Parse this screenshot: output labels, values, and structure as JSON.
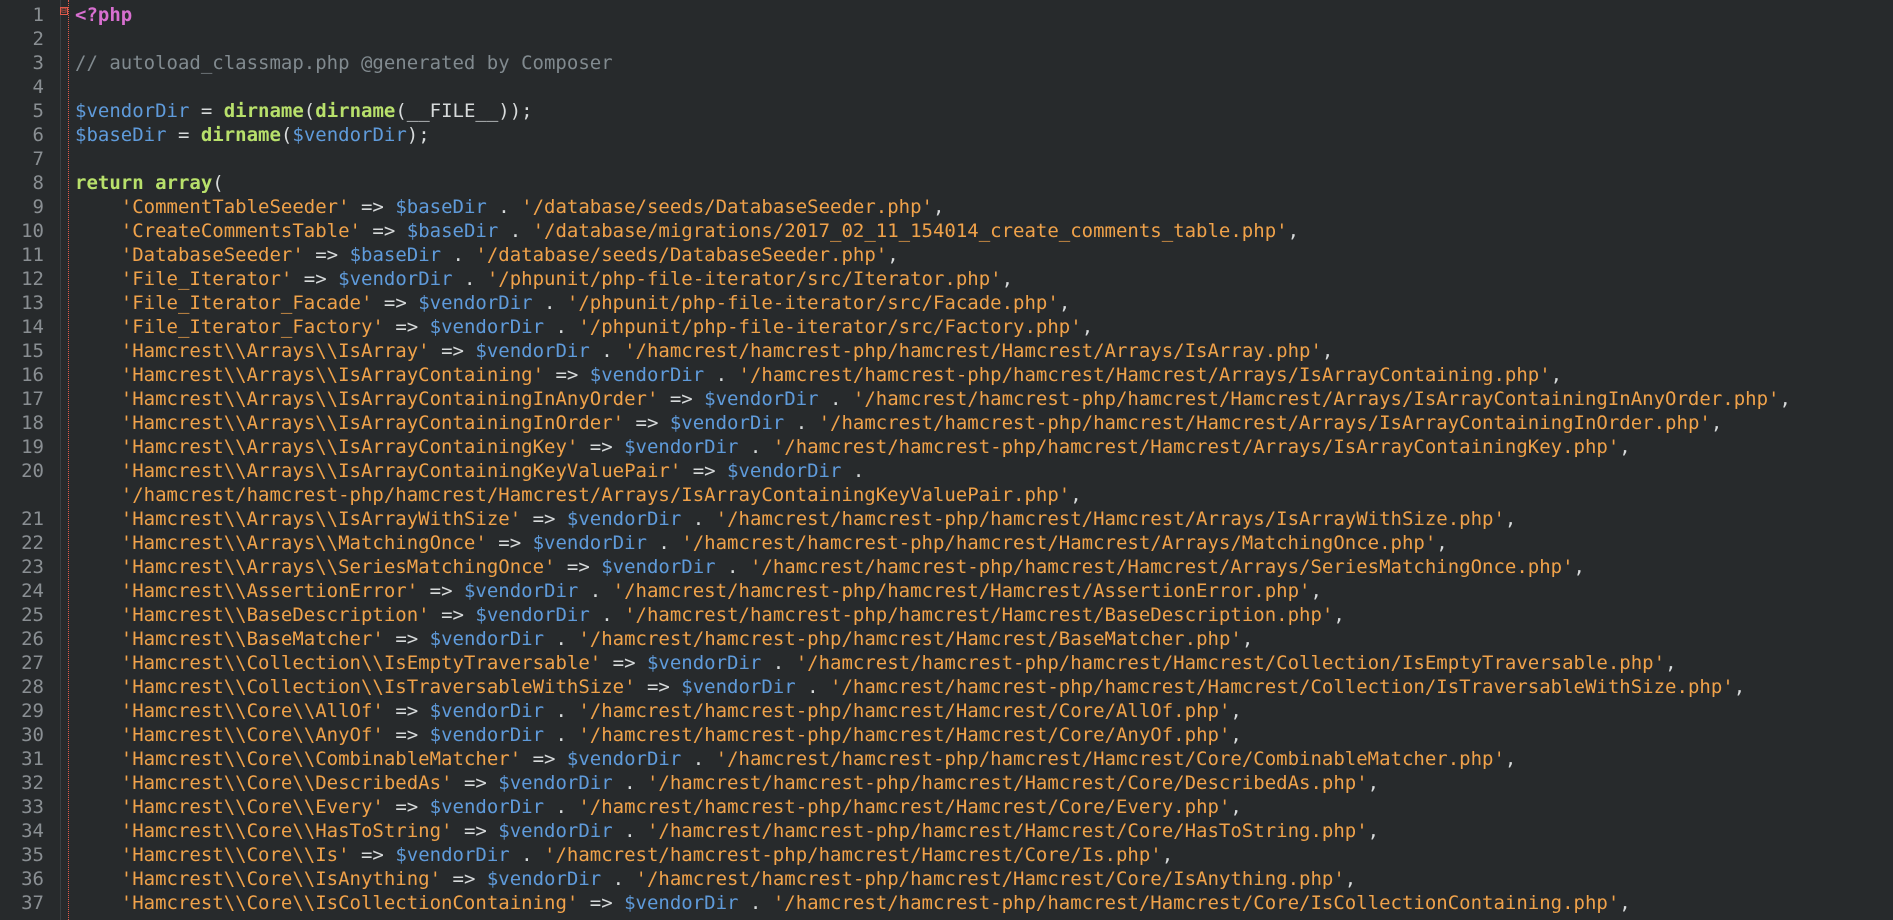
{
  "editor": {
    "fold_marker": "⊟",
    "lines": [
      {
        "n": "1",
        "tokens": [
          [
            "<?php",
            "tag"
          ]
        ]
      },
      {
        "n": "2",
        "tokens": []
      },
      {
        "n": "3",
        "tokens": [
          [
            "// autoload_classmap.php @generated by Composer",
            "comment"
          ]
        ]
      },
      {
        "n": "4",
        "tokens": []
      },
      {
        "n": "5",
        "tokens": [
          [
            "$vendorDir",
            "var"
          ],
          [
            " = ",
            "op"
          ],
          [
            "dirname",
            "fn"
          ],
          [
            "(",
            "paren"
          ],
          [
            "dirname",
            "fn"
          ],
          [
            "(",
            "paren"
          ],
          [
            "__FILE__",
            "const"
          ],
          [
            "));",
            "paren"
          ]
        ]
      },
      {
        "n": "6",
        "tokens": [
          [
            "$baseDir",
            "var"
          ],
          [
            " = ",
            "op"
          ],
          [
            "dirname",
            "fn"
          ],
          [
            "(",
            "paren"
          ],
          [
            "$vendorDir",
            "var"
          ],
          [
            ");",
            "paren"
          ]
        ]
      },
      {
        "n": "7",
        "tokens": []
      },
      {
        "n": "8",
        "tokens": [
          [
            "return",
            "kw"
          ],
          [
            " ",
            "op"
          ],
          [
            "array",
            "kw"
          ],
          [
            "(",
            "paren"
          ]
        ]
      },
      {
        "n": "9",
        "tokens": [
          [
            "    ",
            "op"
          ],
          [
            "'CommentTableSeeder'",
            "str"
          ],
          [
            " => ",
            "op"
          ],
          [
            "$baseDir",
            "var"
          ],
          [
            " . ",
            "op"
          ],
          [
            "'/database/seeds/DatabaseSeeder.php'",
            "str"
          ],
          [
            ",",
            "op"
          ]
        ]
      },
      {
        "n": "10",
        "tokens": [
          [
            "    ",
            "op"
          ],
          [
            "'CreateCommentsTable'",
            "str"
          ],
          [
            " => ",
            "op"
          ],
          [
            "$baseDir",
            "var"
          ],
          [
            " . ",
            "op"
          ],
          [
            "'/database/migrations/2017_02_11_154014_create_comments_table.php'",
            "str"
          ],
          [
            ",",
            "op"
          ]
        ]
      },
      {
        "n": "11",
        "tokens": [
          [
            "    ",
            "op"
          ],
          [
            "'DatabaseSeeder'",
            "str"
          ],
          [
            " => ",
            "op"
          ],
          [
            "$baseDir",
            "var"
          ],
          [
            " . ",
            "op"
          ],
          [
            "'/database/seeds/DatabaseSeeder.php'",
            "str"
          ],
          [
            ",",
            "op"
          ]
        ]
      },
      {
        "n": "12",
        "tokens": [
          [
            "    ",
            "op"
          ],
          [
            "'File_Iterator'",
            "str"
          ],
          [
            " => ",
            "op"
          ],
          [
            "$vendorDir",
            "var"
          ],
          [
            " . ",
            "op"
          ],
          [
            "'/phpunit/php-file-iterator/src/Iterator.php'",
            "str"
          ],
          [
            ",",
            "op"
          ]
        ]
      },
      {
        "n": "13",
        "tokens": [
          [
            "    ",
            "op"
          ],
          [
            "'File_Iterator_Facade'",
            "str"
          ],
          [
            " => ",
            "op"
          ],
          [
            "$vendorDir",
            "var"
          ],
          [
            " . ",
            "op"
          ],
          [
            "'/phpunit/php-file-iterator/src/Facade.php'",
            "str"
          ],
          [
            ",",
            "op"
          ]
        ]
      },
      {
        "n": "14",
        "tokens": [
          [
            "    ",
            "op"
          ],
          [
            "'File_Iterator_Factory'",
            "str"
          ],
          [
            " => ",
            "op"
          ],
          [
            "$vendorDir",
            "var"
          ],
          [
            " . ",
            "op"
          ],
          [
            "'/phpunit/php-file-iterator/src/Factory.php'",
            "str"
          ],
          [
            ",",
            "op"
          ]
        ]
      },
      {
        "n": "15",
        "tokens": [
          [
            "    ",
            "op"
          ],
          [
            "'Hamcrest\\\\Arrays\\\\IsArray'",
            "str"
          ],
          [
            " => ",
            "op"
          ],
          [
            "$vendorDir",
            "var"
          ],
          [
            " . ",
            "op"
          ],
          [
            "'/hamcrest/hamcrest-php/hamcrest/Hamcrest/Arrays/IsArray.php'",
            "str"
          ],
          [
            ",",
            "op"
          ]
        ]
      },
      {
        "n": "16",
        "tokens": [
          [
            "    ",
            "op"
          ],
          [
            "'Hamcrest\\\\Arrays\\\\IsArrayContaining'",
            "str"
          ],
          [
            " => ",
            "op"
          ],
          [
            "$vendorDir",
            "var"
          ],
          [
            " . ",
            "op"
          ],
          [
            "'/hamcrest/hamcrest-php/hamcrest/Hamcrest/Arrays/IsArrayContaining.php'",
            "str"
          ],
          [
            ",",
            "op"
          ]
        ]
      },
      {
        "n": "17",
        "tokens": [
          [
            "    ",
            "op"
          ],
          [
            "'Hamcrest\\\\Arrays\\\\IsArrayContainingInAnyOrder'",
            "str"
          ],
          [
            " => ",
            "op"
          ],
          [
            "$vendorDir",
            "var"
          ],
          [
            " . ",
            "op"
          ],
          [
            "'/hamcrest/hamcrest-php/hamcrest/Hamcrest/Arrays/IsArrayContainingInAnyOrder.php'",
            "str"
          ],
          [
            ",",
            "op"
          ]
        ]
      },
      {
        "n": "18",
        "tokens": [
          [
            "    ",
            "op"
          ],
          [
            "'Hamcrest\\\\Arrays\\\\IsArrayContainingInOrder'",
            "str"
          ],
          [
            " => ",
            "op"
          ],
          [
            "$vendorDir",
            "var"
          ],
          [
            " . ",
            "op"
          ],
          [
            "'/hamcrest/hamcrest-php/hamcrest/Hamcrest/Arrays/IsArrayContainingInOrder.php'",
            "str"
          ],
          [
            ",",
            "op"
          ]
        ]
      },
      {
        "n": "19",
        "tokens": [
          [
            "    ",
            "op"
          ],
          [
            "'Hamcrest\\\\Arrays\\\\IsArrayContainingKey'",
            "str"
          ],
          [
            " => ",
            "op"
          ],
          [
            "$vendorDir",
            "var"
          ],
          [
            " . ",
            "op"
          ],
          [
            "'/hamcrest/hamcrest-php/hamcrest/Hamcrest/Arrays/IsArrayContainingKey.php'",
            "str"
          ],
          [
            ",",
            "op"
          ]
        ]
      },
      {
        "n": "20",
        "tokens": [
          [
            "    ",
            "op"
          ],
          [
            "'Hamcrest\\\\Arrays\\\\IsArrayContainingKeyValuePair'",
            "str"
          ],
          [
            " => ",
            "op"
          ],
          [
            "$vendorDir",
            "var"
          ],
          [
            " .",
            "op"
          ]
        ]
      },
      {
        "n": "",
        "tokens": [
          [
            "    ",
            "op"
          ],
          [
            "'/hamcrest/hamcrest-php/hamcrest/Hamcrest/Arrays/IsArrayContainingKeyValuePair.php'",
            "str"
          ],
          [
            ",",
            "op"
          ]
        ]
      },
      {
        "n": "21",
        "tokens": [
          [
            "    ",
            "op"
          ],
          [
            "'Hamcrest\\\\Arrays\\\\IsArrayWithSize'",
            "str"
          ],
          [
            " => ",
            "op"
          ],
          [
            "$vendorDir",
            "var"
          ],
          [
            " . ",
            "op"
          ],
          [
            "'/hamcrest/hamcrest-php/hamcrest/Hamcrest/Arrays/IsArrayWithSize.php'",
            "str"
          ],
          [
            ",",
            "op"
          ]
        ]
      },
      {
        "n": "22",
        "tokens": [
          [
            "    ",
            "op"
          ],
          [
            "'Hamcrest\\\\Arrays\\\\MatchingOnce'",
            "str"
          ],
          [
            " => ",
            "op"
          ],
          [
            "$vendorDir",
            "var"
          ],
          [
            " . ",
            "op"
          ],
          [
            "'/hamcrest/hamcrest-php/hamcrest/Hamcrest/Arrays/MatchingOnce.php'",
            "str"
          ],
          [
            ",",
            "op"
          ]
        ]
      },
      {
        "n": "23",
        "tokens": [
          [
            "    ",
            "op"
          ],
          [
            "'Hamcrest\\\\Arrays\\\\SeriesMatchingOnce'",
            "str"
          ],
          [
            " => ",
            "op"
          ],
          [
            "$vendorDir",
            "var"
          ],
          [
            " . ",
            "op"
          ],
          [
            "'/hamcrest/hamcrest-php/hamcrest/Hamcrest/Arrays/SeriesMatchingOnce.php'",
            "str"
          ],
          [
            ",",
            "op"
          ]
        ]
      },
      {
        "n": "24",
        "tokens": [
          [
            "    ",
            "op"
          ],
          [
            "'Hamcrest\\\\AssertionError'",
            "str"
          ],
          [
            " => ",
            "op"
          ],
          [
            "$vendorDir",
            "var"
          ],
          [
            " . ",
            "op"
          ],
          [
            "'/hamcrest/hamcrest-php/hamcrest/Hamcrest/AssertionError.php'",
            "str"
          ],
          [
            ",",
            "op"
          ]
        ]
      },
      {
        "n": "25",
        "tokens": [
          [
            "    ",
            "op"
          ],
          [
            "'Hamcrest\\\\BaseDescription'",
            "str"
          ],
          [
            " => ",
            "op"
          ],
          [
            "$vendorDir",
            "var"
          ],
          [
            " . ",
            "op"
          ],
          [
            "'/hamcrest/hamcrest-php/hamcrest/Hamcrest/BaseDescription.php'",
            "str"
          ],
          [
            ",",
            "op"
          ]
        ]
      },
      {
        "n": "26",
        "tokens": [
          [
            "    ",
            "op"
          ],
          [
            "'Hamcrest\\\\BaseMatcher'",
            "str"
          ],
          [
            " => ",
            "op"
          ],
          [
            "$vendorDir",
            "var"
          ],
          [
            " . ",
            "op"
          ],
          [
            "'/hamcrest/hamcrest-php/hamcrest/Hamcrest/BaseMatcher.php'",
            "str"
          ],
          [
            ",",
            "op"
          ]
        ]
      },
      {
        "n": "27",
        "tokens": [
          [
            "    ",
            "op"
          ],
          [
            "'Hamcrest\\\\Collection\\\\IsEmptyTraversable'",
            "str"
          ],
          [
            " => ",
            "op"
          ],
          [
            "$vendorDir",
            "var"
          ],
          [
            " . ",
            "op"
          ],
          [
            "'/hamcrest/hamcrest-php/hamcrest/Hamcrest/Collection/IsEmptyTraversable.php'",
            "str"
          ],
          [
            ",",
            "op"
          ]
        ]
      },
      {
        "n": "28",
        "tokens": [
          [
            "    ",
            "op"
          ],
          [
            "'Hamcrest\\\\Collection\\\\IsTraversableWithSize'",
            "str"
          ],
          [
            " => ",
            "op"
          ],
          [
            "$vendorDir",
            "var"
          ],
          [
            " . ",
            "op"
          ],
          [
            "'/hamcrest/hamcrest-php/hamcrest/Hamcrest/Collection/IsTraversableWithSize.php'",
            "str"
          ],
          [
            ",",
            "op"
          ]
        ]
      },
      {
        "n": "29",
        "tokens": [
          [
            "    ",
            "op"
          ],
          [
            "'Hamcrest\\\\Core\\\\AllOf'",
            "str"
          ],
          [
            " => ",
            "op"
          ],
          [
            "$vendorDir",
            "var"
          ],
          [
            " . ",
            "op"
          ],
          [
            "'/hamcrest/hamcrest-php/hamcrest/Hamcrest/Core/AllOf.php'",
            "str"
          ],
          [
            ",",
            "op"
          ]
        ]
      },
      {
        "n": "30",
        "tokens": [
          [
            "    ",
            "op"
          ],
          [
            "'Hamcrest\\\\Core\\\\AnyOf'",
            "str"
          ],
          [
            " => ",
            "op"
          ],
          [
            "$vendorDir",
            "var"
          ],
          [
            " . ",
            "op"
          ],
          [
            "'/hamcrest/hamcrest-php/hamcrest/Hamcrest/Core/AnyOf.php'",
            "str"
          ],
          [
            ",",
            "op"
          ]
        ]
      },
      {
        "n": "31",
        "tokens": [
          [
            "    ",
            "op"
          ],
          [
            "'Hamcrest\\\\Core\\\\CombinableMatcher'",
            "str"
          ],
          [
            " => ",
            "op"
          ],
          [
            "$vendorDir",
            "var"
          ],
          [
            " . ",
            "op"
          ],
          [
            "'/hamcrest/hamcrest-php/hamcrest/Hamcrest/Core/CombinableMatcher.php'",
            "str"
          ],
          [
            ",",
            "op"
          ]
        ]
      },
      {
        "n": "32",
        "tokens": [
          [
            "    ",
            "op"
          ],
          [
            "'Hamcrest\\\\Core\\\\DescribedAs'",
            "str"
          ],
          [
            " => ",
            "op"
          ],
          [
            "$vendorDir",
            "var"
          ],
          [
            " . ",
            "op"
          ],
          [
            "'/hamcrest/hamcrest-php/hamcrest/Hamcrest/Core/DescribedAs.php'",
            "str"
          ],
          [
            ",",
            "op"
          ]
        ]
      },
      {
        "n": "33",
        "tokens": [
          [
            "    ",
            "op"
          ],
          [
            "'Hamcrest\\\\Core\\\\Every'",
            "str"
          ],
          [
            " => ",
            "op"
          ],
          [
            "$vendorDir",
            "var"
          ],
          [
            " . ",
            "op"
          ],
          [
            "'/hamcrest/hamcrest-php/hamcrest/Hamcrest/Core/Every.php'",
            "str"
          ],
          [
            ",",
            "op"
          ]
        ]
      },
      {
        "n": "34",
        "tokens": [
          [
            "    ",
            "op"
          ],
          [
            "'Hamcrest\\\\Core\\\\HasToString'",
            "str"
          ],
          [
            " => ",
            "op"
          ],
          [
            "$vendorDir",
            "var"
          ],
          [
            " . ",
            "op"
          ],
          [
            "'/hamcrest/hamcrest-php/hamcrest/Hamcrest/Core/HasToString.php'",
            "str"
          ],
          [
            ",",
            "op"
          ]
        ]
      },
      {
        "n": "35",
        "tokens": [
          [
            "    ",
            "op"
          ],
          [
            "'Hamcrest\\\\Core\\\\Is'",
            "str"
          ],
          [
            " => ",
            "op"
          ],
          [
            "$vendorDir",
            "var"
          ],
          [
            " . ",
            "op"
          ],
          [
            "'/hamcrest/hamcrest-php/hamcrest/Hamcrest/Core/Is.php'",
            "str"
          ],
          [
            ",",
            "op"
          ]
        ]
      },
      {
        "n": "36",
        "tokens": [
          [
            "    ",
            "op"
          ],
          [
            "'Hamcrest\\\\Core\\\\IsAnything'",
            "str"
          ],
          [
            " => ",
            "op"
          ],
          [
            "$vendorDir",
            "var"
          ],
          [
            " . ",
            "op"
          ],
          [
            "'/hamcrest/hamcrest-php/hamcrest/Hamcrest/Core/IsAnything.php'",
            "str"
          ],
          [
            ",",
            "op"
          ]
        ]
      },
      {
        "n": "37",
        "tokens": [
          [
            "    ",
            "op"
          ],
          [
            "'Hamcrest\\\\Core\\\\IsCollectionContaining'",
            "str"
          ],
          [
            " => ",
            "op"
          ],
          [
            "$vendorDir",
            "var"
          ],
          [
            " . ",
            "op"
          ],
          [
            "'/hamcrest/hamcrest-php/hamcrest/Hamcrest/Core/IsCollectionContaining.php'",
            "str"
          ],
          [
            ",",
            "op"
          ]
        ]
      }
    ]
  }
}
